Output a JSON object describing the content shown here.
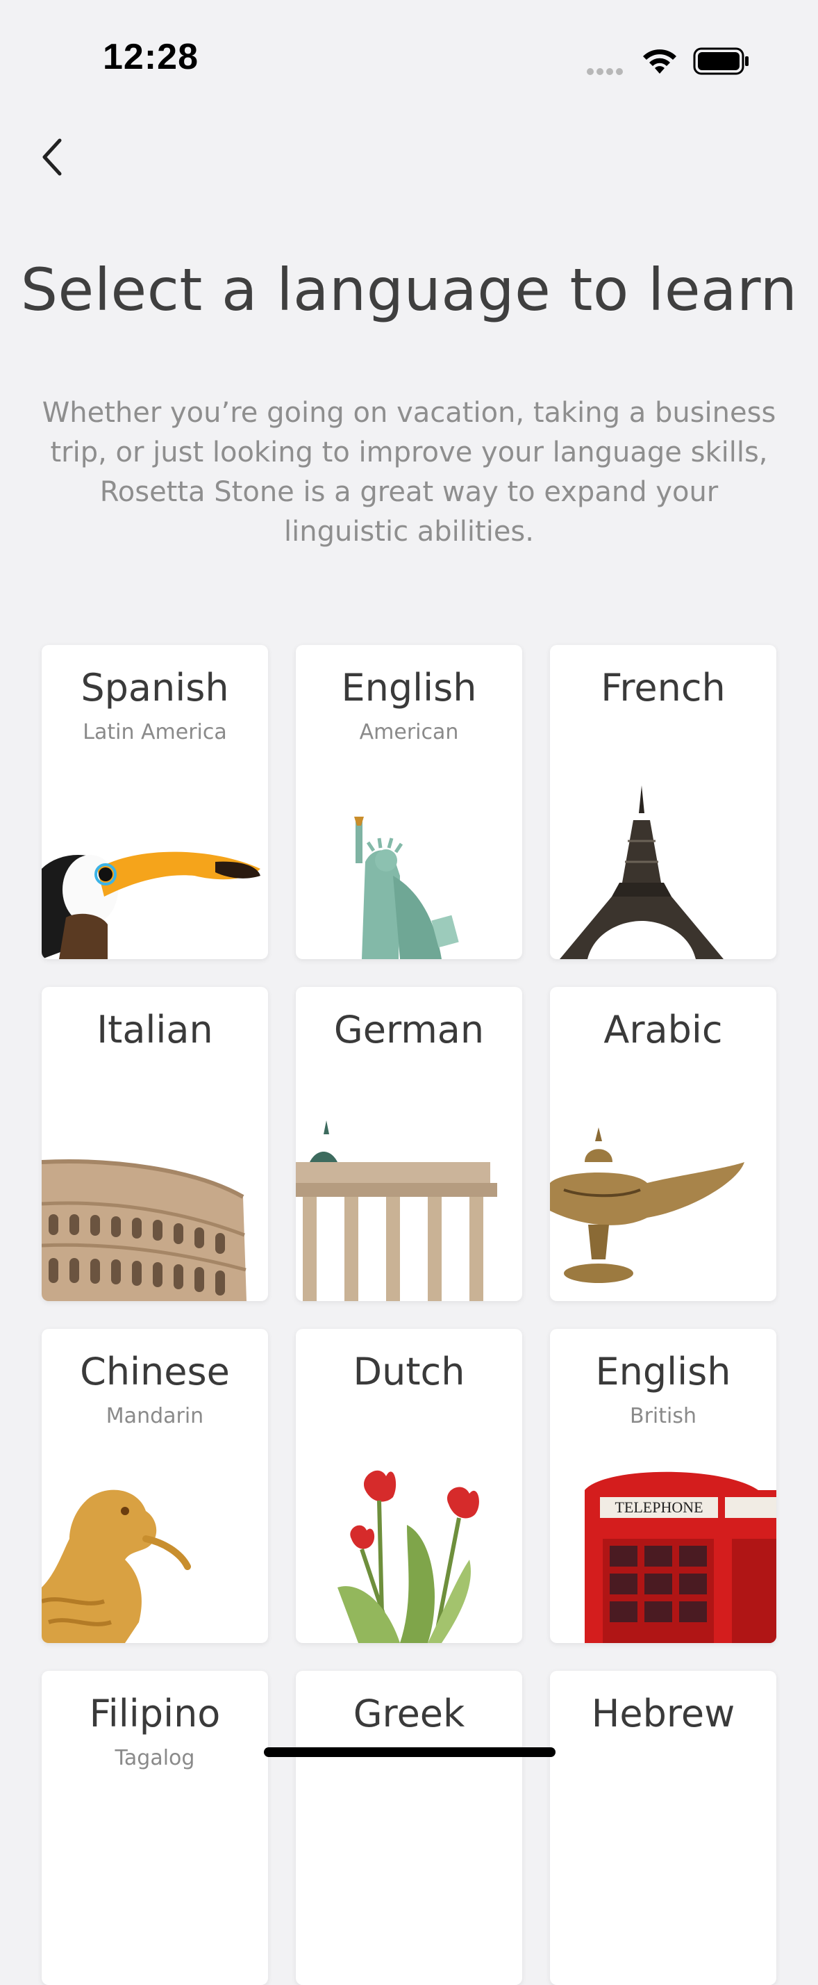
{
  "status_bar": {
    "time": "12:28"
  },
  "header": {
    "title": "Select a language to learn",
    "subtitle": "Whether you’re going on vacation, taking a business trip, or just looking to improve your language skills, Rosetta Stone is a great way to expand your linguistic abilities."
  },
  "languages": [
    {
      "name": "Spanish",
      "variant": "Latin America",
      "image": "toucan"
    },
    {
      "name": "English",
      "variant": "American",
      "image": "statue-of-liberty"
    },
    {
      "name": "French",
      "variant": "",
      "image": "eiffel-tower"
    },
    {
      "name": "Italian",
      "variant": "",
      "image": "colosseum"
    },
    {
      "name": "German",
      "variant": "",
      "image": "brandenburg-gate"
    },
    {
      "name": "Arabic",
      "variant": "",
      "image": "oil-lamp"
    },
    {
      "name": "Chinese",
      "variant": "Mandarin",
      "image": "dragon"
    },
    {
      "name": "Dutch",
      "variant": "",
      "image": "tulips"
    },
    {
      "name": "English",
      "variant": "British",
      "image": "phone-booth"
    },
    {
      "name": "Filipino",
      "variant": "Tagalog",
      "image": ""
    },
    {
      "name": "Greek",
      "variant": "",
      "image": ""
    },
    {
      "name": "Hebrew",
      "variant": "",
      "image": ""
    }
  ],
  "phone_booth_sign": "TELEPHONE",
  "colors": {
    "background": "#f2f2f4",
    "card": "#ffffff",
    "title": "#3f3f3f",
    "subtitle": "#8e8e8e"
  }
}
